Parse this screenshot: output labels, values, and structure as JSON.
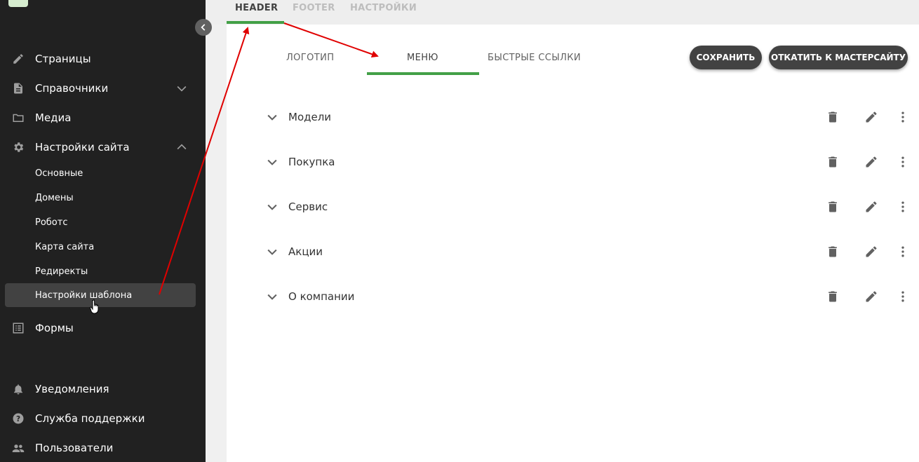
{
  "sidebar": {
    "nav": [
      {
        "label": "Страницы",
        "icon": "pencil-icon"
      },
      {
        "label": "Справочники",
        "icon": "document-icon"
      },
      {
        "label": "Медиа",
        "icon": "folder-icon"
      },
      {
        "label": "Настройки сайта",
        "icon": "gear-icon"
      },
      {
        "label": "Формы",
        "icon": "list-icon"
      }
    ],
    "sub": [
      {
        "label": "Основные"
      },
      {
        "label": "Домены"
      },
      {
        "label": "Роботс"
      },
      {
        "label": "Карта сайта"
      },
      {
        "label": "Редиректы"
      },
      {
        "label": "Настройки шаблона"
      }
    ],
    "bottom": [
      {
        "label": "Уведомления",
        "icon": "bell-icon"
      },
      {
        "label": "Служба поддержки",
        "icon": "help-icon"
      },
      {
        "label": "Пользователи",
        "icon": "users-icon"
      }
    ]
  },
  "top_tabs": [
    {
      "label": "HEADER",
      "active": true
    },
    {
      "label": "FOOTER",
      "active": false
    },
    {
      "label": "НАСТРОЙКИ",
      "active": false
    }
  ],
  "sub_tabs": [
    {
      "label": "ЛОГОТИП"
    },
    {
      "label": "МЕНЮ",
      "active": true
    },
    {
      "label": "БЫСТРЫЕ ССЫЛКИ"
    }
  ],
  "buttons": {
    "save": "СОХРАНИТЬ",
    "revert": "ОТКАТИТЬ К МАСТЕРСАЙТУ"
  },
  "menu_items": [
    {
      "name": "Модели"
    },
    {
      "name": "Покупка"
    },
    {
      "name": "Сервис"
    },
    {
      "name": "Акции"
    },
    {
      "name": "О компании"
    }
  ],
  "colors": {
    "sidebar_bg": "#212121",
    "accent_green": "#43a047",
    "annotation_red": "#e00000"
  }
}
